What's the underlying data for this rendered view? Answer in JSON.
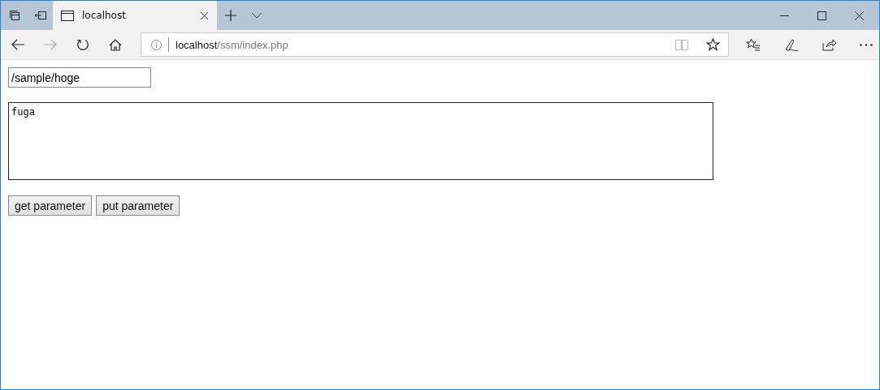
{
  "tabs": [
    {
      "title": "localhost",
      "selected": true
    }
  ],
  "address": {
    "host": "localhost",
    "path": "/ssm/index.php"
  },
  "form": {
    "path_value": "/sample/hoge",
    "body_value": "fuga",
    "buttons": [
      "get parameter",
      "put parameter"
    ]
  }
}
